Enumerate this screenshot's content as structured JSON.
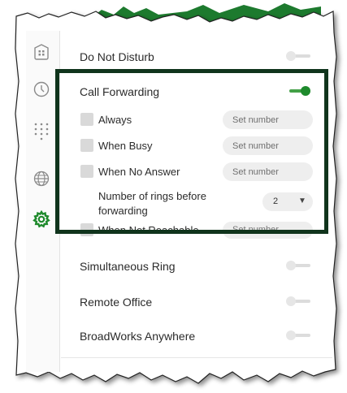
{
  "settings": {
    "do_not_disturb": {
      "label": "Do Not Disturb",
      "enabled": false
    },
    "call_forwarding": {
      "label": "Call Forwarding",
      "enabled": true,
      "options": [
        {
          "label": "Always",
          "placeholder": "Set number",
          "checked": false
        },
        {
          "label": "When Busy",
          "placeholder": "Set number",
          "checked": false
        },
        {
          "label": "When No Answer",
          "placeholder": "Set number",
          "checked": false
        }
      ],
      "rings_label_line1": "Number of rings before",
      "rings_label_line2": "forwarding",
      "rings_value": "2",
      "rings_arrow": "▼",
      "partially_hidden": {
        "label": "When Not Reachable",
        "placeholder": "Set number"
      }
    },
    "simultaneous_ring": {
      "label": "Simultaneous Ring",
      "enabled": false
    },
    "remote_office": {
      "label": "Remote Office",
      "enabled": false
    },
    "broadworks_anywhere": {
      "label": "BroadWorks Anywhere",
      "enabled": false
    }
  },
  "sidebar": {
    "icons": [
      "contacts-icon",
      "history-icon",
      "dialpad-icon",
      "globe-icon",
      "settings-icon"
    ],
    "active": "settings-icon"
  },
  "colors": {
    "accent_green": "#1e8a2c",
    "highlight_border": "#10341c",
    "toggle_off": "#dcdcdc",
    "field_bg": "#eeeeee"
  }
}
